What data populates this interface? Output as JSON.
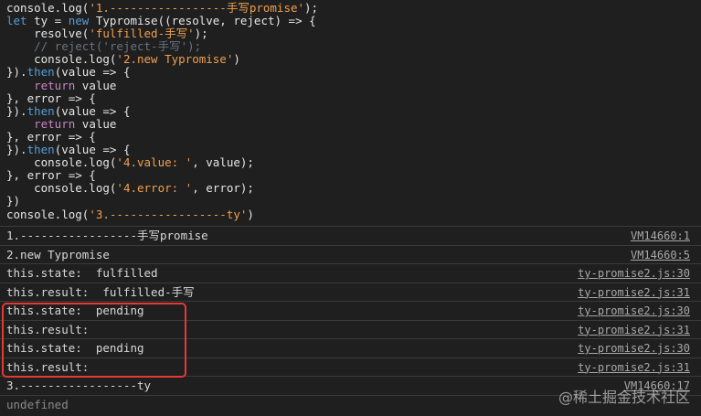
{
  "code_lines": [
    [
      {
        "c": "plain",
        "t": "console.log("
      },
      {
        "c": "str",
        "t": "'1.-----------------手写promise'"
      },
      {
        "c": "plain",
        "t": ");"
      }
    ],
    [
      {
        "c": "kw2",
        "t": "let"
      },
      {
        "c": "plain",
        "t": " ty = "
      },
      {
        "c": "kw2",
        "t": "new"
      },
      {
        "c": "plain",
        "t": " Typromise((resolve, reject) => {"
      }
    ],
    [
      {
        "c": "plain",
        "t": "    resolve("
      },
      {
        "c": "str",
        "t": "'fulfilled-手写'"
      },
      {
        "c": "plain",
        "t": ");"
      }
    ],
    [
      {
        "c": "cmt",
        "t": "    // reject('reject-手写');"
      }
    ],
    [
      {
        "c": "plain",
        "t": "    console.log("
      },
      {
        "c": "str",
        "t": "'2.new Typromise'"
      },
      {
        "c": "plain",
        "t": ")"
      }
    ],
    [
      {
        "c": "plain",
        "t": "})."
      },
      {
        "c": "kw2",
        "t": "then"
      },
      {
        "c": "plain",
        "t": "(value => {"
      }
    ],
    [
      {
        "c": "kw",
        "t": "    return"
      },
      {
        "c": "plain",
        "t": " value"
      }
    ],
    [
      {
        "c": "plain",
        "t": "}, error => {"
      }
    ],
    [
      {
        "c": "plain",
        "t": "})."
      },
      {
        "c": "kw2",
        "t": "then"
      },
      {
        "c": "plain",
        "t": "(value => {"
      }
    ],
    [
      {
        "c": "kw",
        "t": "    return"
      },
      {
        "c": "plain",
        "t": " value"
      }
    ],
    [
      {
        "c": "plain",
        "t": "}, error => {"
      }
    ],
    [
      {
        "c": "plain",
        "t": "})."
      },
      {
        "c": "kw2",
        "t": "then"
      },
      {
        "c": "plain",
        "t": "(value => {"
      }
    ],
    [
      {
        "c": "plain",
        "t": "    console.log("
      },
      {
        "c": "str",
        "t": "'4.value: '"
      },
      {
        "c": "plain",
        "t": ", value);"
      }
    ],
    [
      {
        "c": "plain",
        "t": "}, error => {"
      }
    ],
    [
      {
        "c": "plain",
        "t": "    console.log("
      },
      {
        "c": "str",
        "t": "'4.error: '"
      },
      {
        "c": "plain",
        "t": ", error);"
      }
    ],
    [
      {
        "c": "plain",
        "t": "})"
      }
    ],
    [
      {
        "c": "plain",
        "t": "console.log("
      },
      {
        "c": "str",
        "t": "'3.-----------------ty'"
      },
      {
        "c": "plain",
        "t": ")"
      }
    ]
  ],
  "console": {
    "rows": [
      {
        "msg": "1.-----------------手写promise",
        "src": "VM14660:1"
      },
      {
        "msg": "2.new Typromise",
        "src": "VM14660:5"
      },
      {
        "msg": "this.state:  fulfilled",
        "src": "ty-promise2.js:30"
      },
      {
        "msg": "this.result:  fulfilled-手写",
        "src": "ty-promise2.js:31"
      },
      {
        "msg": "this.state:  pending",
        "src": "ty-promise2.js:30"
      },
      {
        "msg": "this.result:",
        "src": "ty-promise2.js:31"
      },
      {
        "msg": "this.state:  pending",
        "src": "ty-promise2.js:30"
      },
      {
        "msg": "this.result:",
        "src": "ty-promise2.js:31"
      },
      {
        "msg": "3.-----------------ty",
        "src": "VM14660:17"
      }
    ],
    "final": "undefined"
  },
  "watermark": "@稀土掘金技术社区"
}
